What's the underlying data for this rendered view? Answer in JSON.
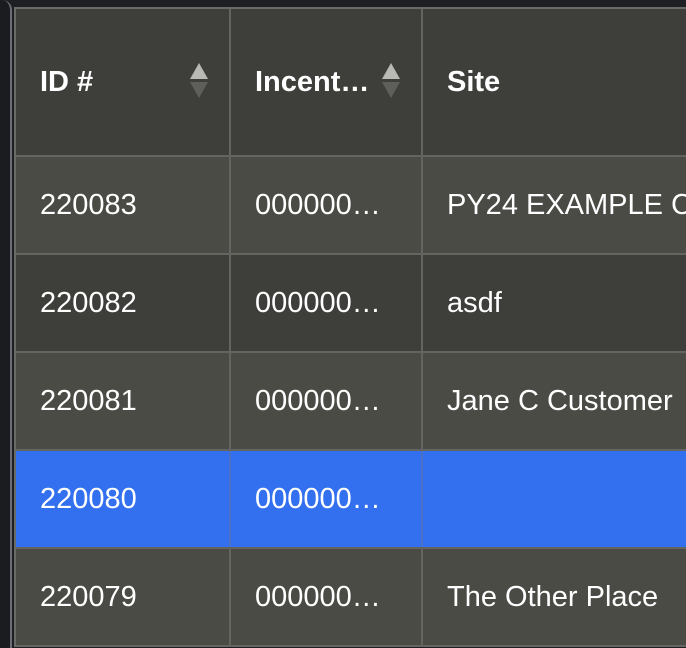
{
  "table": {
    "columns": [
      {
        "label": "ID #",
        "sort_icon": "sort-arrows-icon"
      },
      {
        "label": "Incent…",
        "sort_icon": "sort-arrows-icon"
      },
      {
        "label": "Site"
      }
    ],
    "rows": [
      {
        "id": "220083",
        "incentive": "000000…",
        "site": "PY24 EXAMPLE C"
      },
      {
        "id": "220082",
        "incentive": "000000…",
        "site": "asdf"
      },
      {
        "id": "220081",
        "incentive": "000000…",
        "site": "Jane C Customer"
      },
      {
        "id": "220080",
        "incentive": "000000…",
        "site": "",
        "selected": true
      },
      {
        "id": "220079",
        "incentive": "000000…",
        "site": "The Other Place"
      }
    ]
  },
  "colors": {
    "header_bg": "#3e3f3a",
    "row_odd": "#4a4b45",
    "row_even": "#3e3f3a",
    "selected_bg": "#3370f0",
    "text": "#ffffff"
  }
}
